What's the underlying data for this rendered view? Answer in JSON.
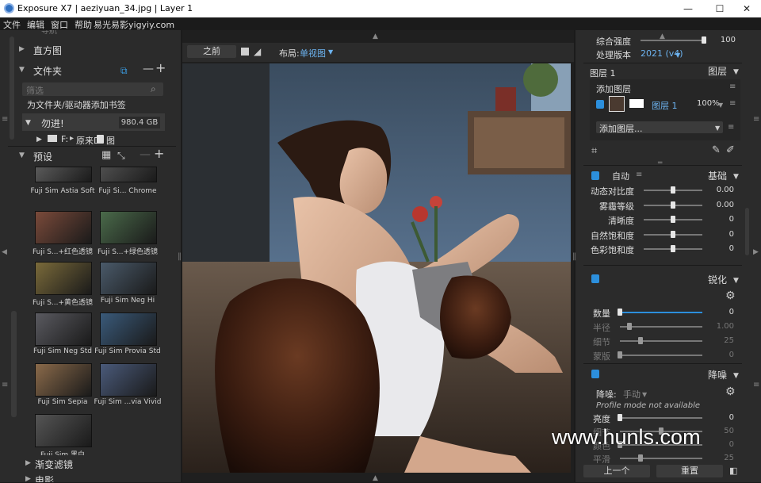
{
  "titlebar": {
    "title": "Exposure X7 | aeziyuan_34.jpg | Layer 1",
    "minimize": "—",
    "maximize": "☐",
    "close": "✕"
  },
  "menu": {
    "file": "文件",
    "edit": "编辑",
    "window": "窗口",
    "help": "帮助",
    "brand": "易光易影yigyiy.com"
  },
  "left": {
    "partial_top": "导航",
    "histogram": "直方图",
    "folders": "文件夹",
    "filter_placeholder": "筛选",
    "bookmark": "为文件夹/驱动器添加书签",
    "drive_name": "勿进!",
    "drive_size": "980.4 GB",
    "folder_path": "F:",
    "folder_name": "原来D",
    "folder_suffix": "图",
    "presets": "预设",
    "preset_items": [
      {
        "label": "Fuji Sim Astia Soft"
      },
      {
        "label": "Fuji Si... Chrome"
      },
      {
        "label": "Fuji S...+红色透镜"
      },
      {
        "label": "Fuji S...+绿色透镜"
      },
      {
        "label": "Fuji S...+黄色透镜"
      },
      {
        "label": "Fuji Sim Neg Hi"
      },
      {
        "label": "Fuji Sim Neg Std"
      },
      {
        "label": "Fuji Sim Provia Std"
      },
      {
        "label": "Fuji Sim Sepia"
      },
      {
        "label": "Fuji Sim ...via Vivid"
      },
      {
        "label": "Fuji Sim 黑白"
      }
    ],
    "gradient": "渐变滤镜",
    "film": "电影"
  },
  "viewer": {
    "before": "之前",
    "layout_label": "布局:",
    "layout_value": "单视图"
  },
  "right": {
    "strength_label": "综合强度",
    "strength_value": "100",
    "strength_level": 1.0,
    "version_label": "处理版本",
    "version_value": "2021 (v4)",
    "layer_name": "图层 1",
    "layers_header": "图层",
    "add_layer": "添加图层",
    "layer_row_name": "图层 1",
    "layer_opacity": "100%",
    "add_layer_dropdown": "添加图层...",
    "auto": "自动",
    "basic": "基础",
    "basic_sliders": [
      {
        "label": "动态对比度",
        "value": "0.00",
        "level": 0.5
      },
      {
        "label": "雾霾等级",
        "value": "0.00",
        "level": 0.5
      },
      {
        "label": "清晰度",
        "value": "0",
        "level": 0.5
      },
      {
        "label": "自然饱和度",
        "value": "0",
        "level": 0.5
      },
      {
        "label": "色彩饱和度",
        "value": "0",
        "level": 0.5
      }
    ],
    "sharpen": "锐化",
    "sharpen_sliders": [
      {
        "label": "数量",
        "value": "0",
        "level": 0.0
      },
      {
        "label": "半径",
        "value": "1.00",
        "level": 0.12
      },
      {
        "label": "细节",
        "value": "25",
        "level": 0.25
      },
      {
        "label": "蒙版",
        "value": "0",
        "level": 0.0
      }
    ],
    "noise": "降噪",
    "noise_mode_label": "降噪:",
    "noise_mode_value": "手动",
    "profile_text": "Profile mode not available",
    "noise_sliders": [
      {
        "label": "亮度",
        "value": "0",
        "level": 0.0
      },
      {
        "label": "细节",
        "value": "50",
        "level": 0.5
      },
      {
        "label": "颜色",
        "value": "0",
        "level": 0.0
      },
      {
        "label": "平滑",
        "value": "25",
        "level": 0.25
      }
    ],
    "prev_button": "上一个",
    "reset_button": "重置"
  },
  "watermark": "www.hunls.com",
  "colors": {
    "accent": "#2c8fdc",
    "panel": "#2b2b2b",
    "background": "#1b1b1b"
  }
}
